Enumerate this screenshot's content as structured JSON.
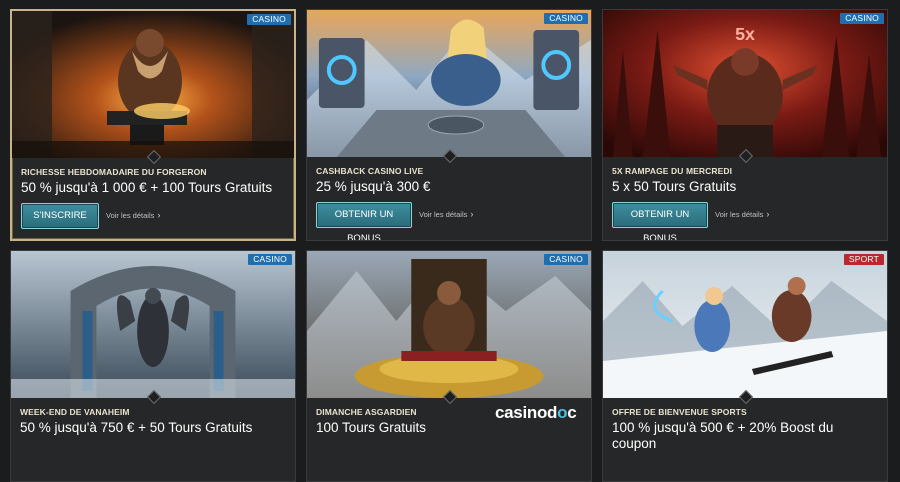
{
  "cards": [
    {
      "badge": "CASINO",
      "subtitle": "RICHESSE HEBDOMADAIRE DU FORGERON",
      "title": "50 % jusqu'à 1 000 € + 100 Tours Gratuits",
      "cta": "S'INSCRIRE",
      "details": "Voir les détails"
    },
    {
      "badge": "CASINO",
      "subtitle": "CASHBACK CASINO LIVE",
      "title": "25 % jusqu'à 300 €",
      "cta": "OBTENIR UN BONUS",
      "details": "Voir les détails"
    },
    {
      "badge": "CASINO",
      "subtitle": "5X RAMPAGE DU MERCREDI",
      "title": "5 x 50 Tours Gratuits",
      "cta": "OBTENIR UN BONUS",
      "details": "Voir les détails",
      "art_text": "5x"
    },
    {
      "badge": "CASINO",
      "subtitle": "WEEK-END DE VANAHEIM",
      "title": "50 % jusqu'à 750 € + 50 Tours Gratuits"
    },
    {
      "badge": "CASINO",
      "subtitle": "DIMANCHE ASGARDIEN",
      "title": "100 Tours Gratuits"
    },
    {
      "badge": "SPORT",
      "subtitle": "OFFRE DE BIENVENUE SPORTS",
      "title": "100 % jusqu'à 500 € + 20% Boost du coupon"
    }
  ],
  "watermark": {
    "part1": "casinod",
    "part2": "o",
    "part3": "c"
  },
  "colors": {
    "casino_badge": "#1f6fb0",
    "sport_badge": "#b8282c",
    "cta": "#2f7f8f",
    "featured_border": "#c8b488"
  }
}
